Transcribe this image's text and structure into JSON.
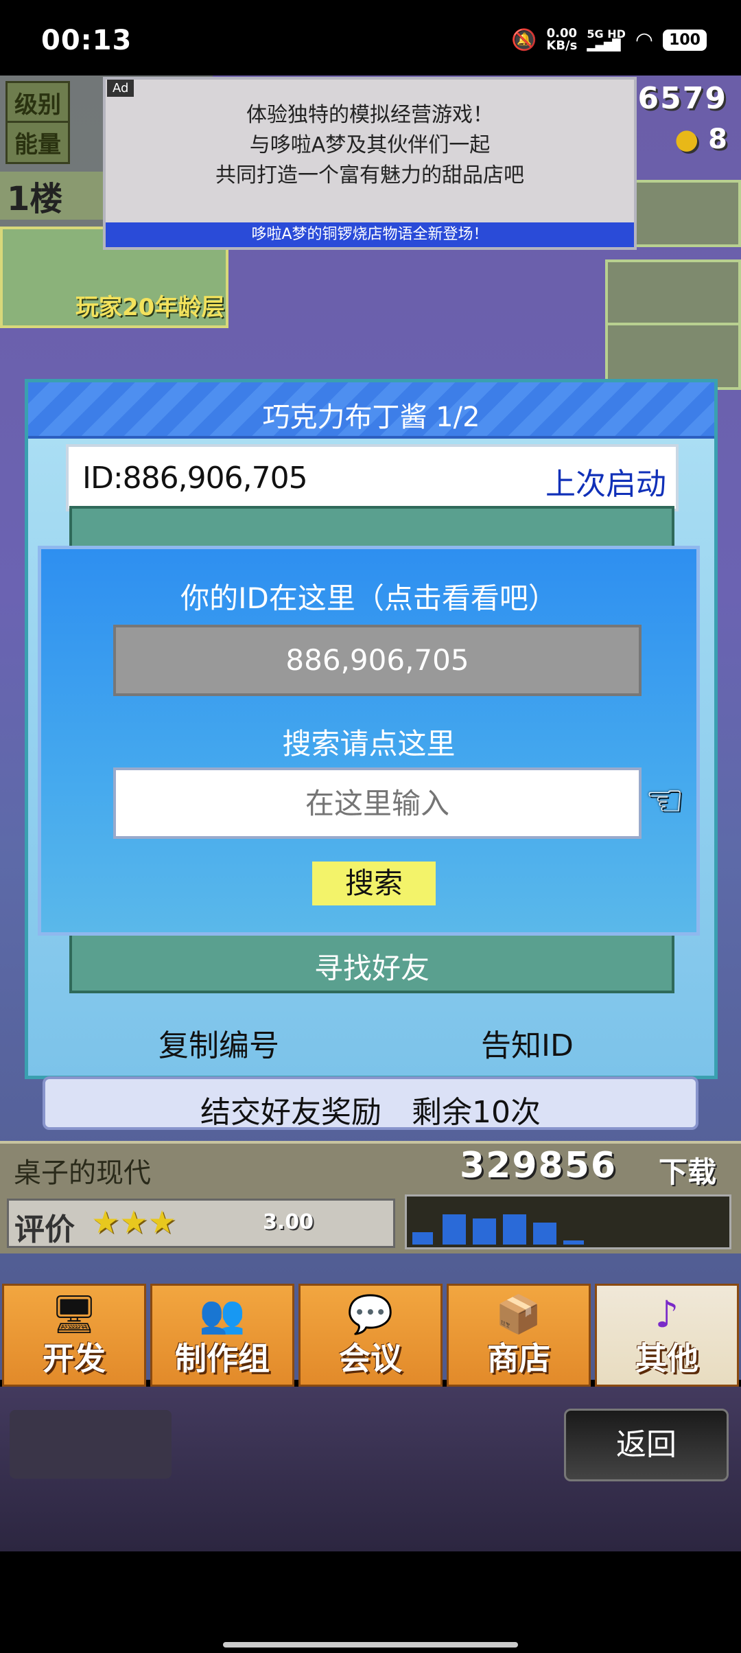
{
  "status": {
    "time": "00:13",
    "net_speed": "0.00",
    "net_unit": "KB/s",
    "network": "5G HD",
    "battery": "100"
  },
  "hud": {
    "level_label": "级别",
    "energy_label": "能量",
    "floor": "1楼",
    "age_badge": "玩家20年龄层",
    "money": "6579",
    "coin": "8"
  },
  "ad": {
    "tag": "Ad",
    "line1": "体验独特的模拟经营游戏！",
    "line2": "与哆啦A梦及其伙伴们一起",
    "line3": "共同打造一个富有魅力的甜品店吧",
    "strip": "哆啦A梦的铜锣烧店物语全新登场！"
  },
  "panel": {
    "title": "巧克力布丁酱 1/2",
    "id_text": "ID:886,906,705",
    "last_login": "上次启动",
    "find_friend": "寻找好友",
    "copy_button": "复制编号",
    "notify_button": "告知ID"
  },
  "dialog": {
    "id_heading": "你的ID在这里（点击看看吧）",
    "id_value": "886,906,705",
    "search_heading": "搜索请点这里",
    "search_placeholder": "在这里输入",
    "search_button": "搜索"
  },
  "reward": {
    "text": "结交好友奖励　剩余10次"
  },
  "desk": {
    "title": "桌子的现代",
    "number": "329856",
    "unit": "下载",
    "rating_label": "评价",
    "stars": "★★★",
    "score": "3.00"
  },
  "menu": {
    "items": [
      {
        "label": "开发",
        "icon": "computer-icon"
      },
      {
        "label": "制作组",
        "icon": "team-icon"
      },
      {
        "label": "会议",
        "icon": "meeting-icon"
      },
      {
        "label": "商店",
        "icon": "shop-icon"
      },
      {
        "label": "其他",
        "icon": "music-note-icon"
      }
    ]
  },
  "bottom": {
    "back_button": "返回"
  }
}
